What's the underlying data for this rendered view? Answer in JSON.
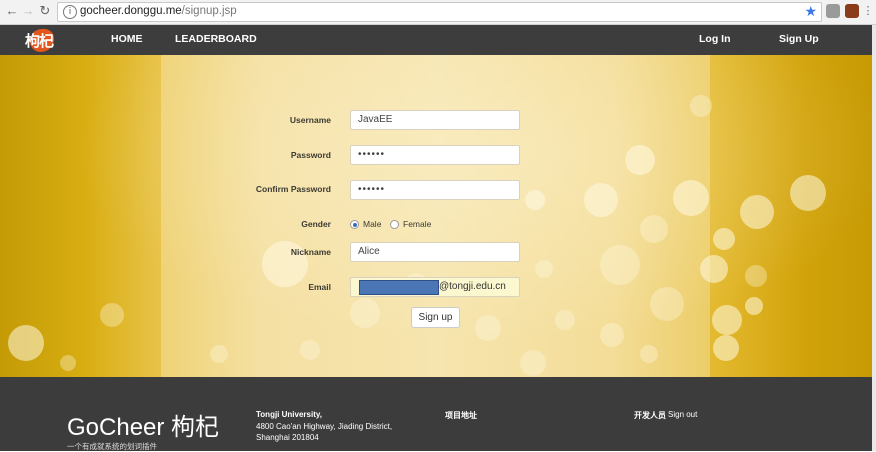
{
  "browser": {
    "url_host": "gocheer.donggu.me",
    "url_path": "/signup.jsp"
  },
  "navbar": {
    "logo_text": "枸杞",
    "home": "HOME",
    "leaderboard": "LEADERBOARD",
    "login": "Log In",
    "signup": "Sign Up"
  },
  "form": {
    "username_label": "Username",
    "username_value": "JavaEE",
    "password_label": "Password",
    "password_value": "••••••",
    "confirm_label": "Confirm Password",
    "confirm_value": "••••••",
    "gender_label": "Gender",
    "gender_male": "Male",
    "gender_female": "Female",
    "gender_selected": "Male",
    "nickname_label": "Nickname",
    "nickname_value": "Alice",
    "email_label": "Email",
    "email_domain": "@tongji.edu.cn",
    "submit": "Sign up"
  },
  "footer": {
    "brand": "GoCheer 枸杞",
    "tagline": "一个有成就系统的划词插件",
    "university": "Tongji University,",
    "address_line1": "4800 Cao'an Highway, Jiading District,",
    "address_line2": "Shanghai 201804",
    "project_link": "项目地址",
    "developers": "开发人员",
    "signout": "Sign out"
  },
  "colors": {
    "navbar_bg": "#3d3d3d",
    "footer_bg": "#3c3c3c",
    "hero_gold": "#d9ae13",
    "logo_orange": "#e3561e"
  }
}
